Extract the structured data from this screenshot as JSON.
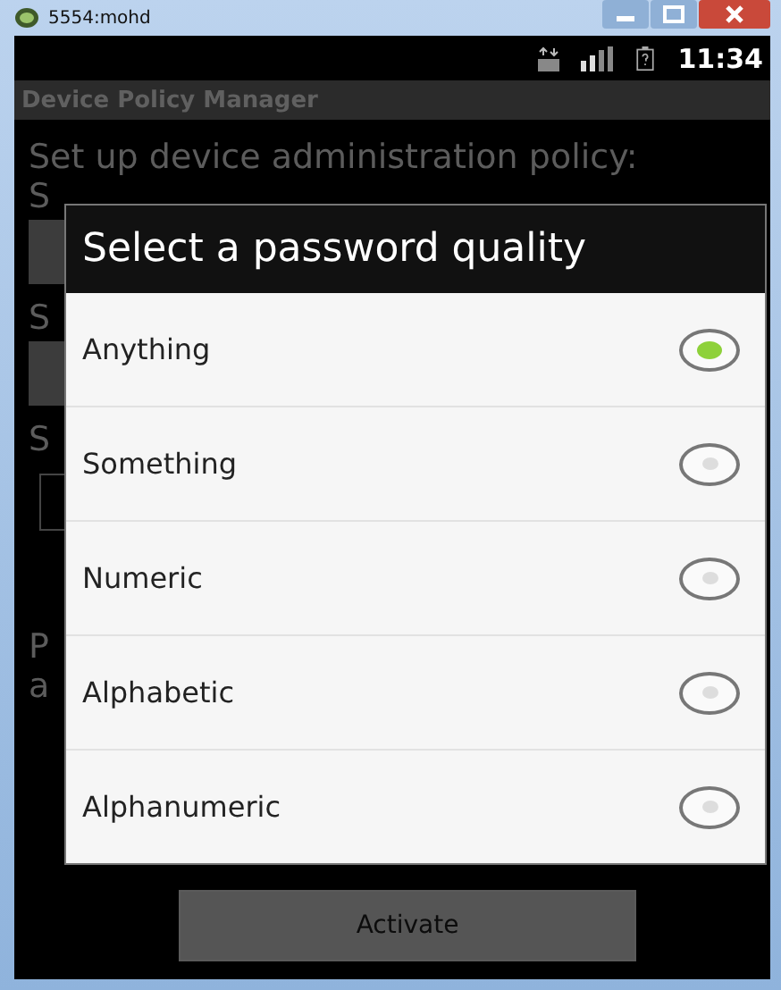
{
  "window": {
    "title": "5554:mohd"
  },
  "status_bar": {
    "time": "11:34"
  },
  "app": {
    "title": "Device Policy Manager",
    "heading": "Set up device administration policy:",
    "background_labels": [
      "S",
      "S",
      "S"
    ],
    "footer_fragments": [
      "P",
      "a"
    ],
    "button": "Activate"
  },
  "dialog": {
    "title": "Select a password quality",
    "options": [
      {
        "label": "Anything",
        "selected": true
      },
      {
        "label": "Something",
        "selected": false
      },
      {
        "label": "Numeric",
        "selected": false
      },
      {
        "label": "Alphabetic",
        "selected": false
      },
      {
        "label": "Alphanumeric",
        "selected": false
      }
    ]
  }
}
